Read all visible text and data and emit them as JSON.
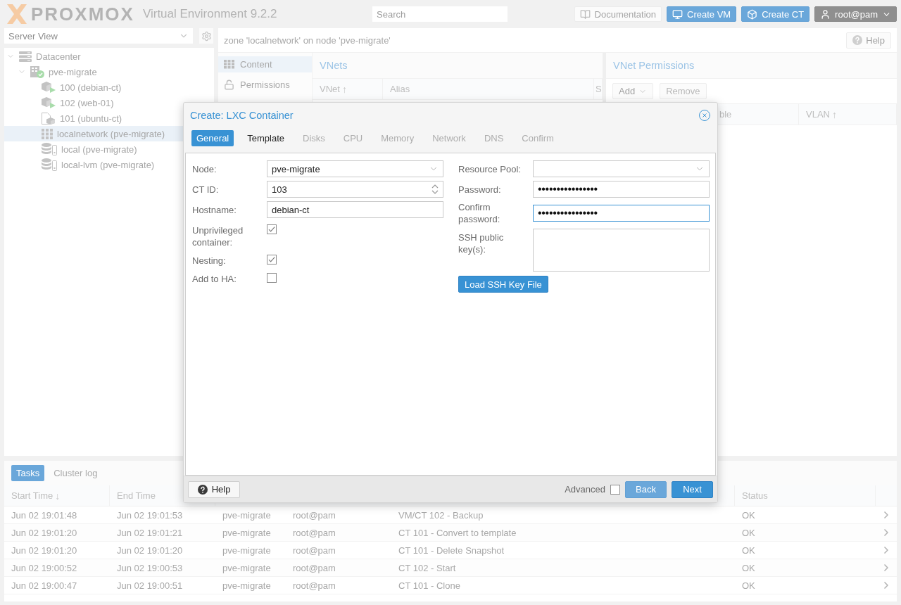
{
  "header": {
    "logo": "PROXMOX",
    "product": "Virtual Environment 9.2.2",
    "search": {
      "placeholder": "Search"
    },
    "buttons": [
      {
        "kind": "docs",
        "label": "Documentation"
      },
      {
        "kind": "create-vm",
        "label": "Create VM"
      },
      {
        "kind": "create-ct",
        "label": "Create CT"
      },
      {
        "kind": "user",
        "label": "root@pam"
      }
    ]
  },
  "view_selector": {
    "value": "Server View"
  },
  "tree": [
    {
      "label": "Datacenter",
      "kind": "datacenter",
      "expanded": true,
      "selected": false,
      "children": [
        {
          "label": "pve-migrate",
          "kind": "node",
          "expanded": true,
          "selected": false,
          "children": [
            {
              "label": "100 (debian-ct)",
              "kind": "ct-running",
              "selected": false
            },
            {
              "label": "102 (web-01)",
              "kind": "ct-running",
              "selected": false
            },
            {
              "label": "101 (ubuntu-ct)",
              "kind": "ct-template",
              "selected": false
            },
            {
              "label": "localnetwork (pve-migrate)",
              "kind": "zone",
              "selected": true
            },
            {
              "label": "local (pve-migrate)",
              "kind": "storage",
              "selected": false
            },
            {
              "label": "local-lvm (pve-migrate)",
              "kind": "storage",
              "selected": false
            }
          ]
        }
      ]
    }
  ],
  "content": {
    "title": "zone 'localnetwork' on node 'pve-migrate'",
    "help_button": "Help",
    "nav": [
      {
        "label": "Content",
        "kind": "content",
        "selected": true
      },
      {
        "label": "Permissions",
        "kind": "permissions",
        "selected": false
      }
    ],
    "vnets": {
      "title": "VNets",
      "columns": [
        {
          "label": "VNet",
          "sort": "↑"
        },
        {
          "label": "Alias"
        },
        {
          "label": "S"
        }
      ]
    },
    "vnet_permissions": {
      "title": "VNet Permissions",
      "toolbar": [
        {
          "label": "Add",
          "kind": "menu",
          "disabled": false
        },
        {
          "label": "Remove",
          "kind": "plain",
          "disabled": true
        }
      ],
      "columns": [
        {
          "label": "ble"
        },
        {
          "label": "VLAN",
          "sort": "↑"
        }
      ]
    }
  },
  "bottom": {
    "tabs": [
      {
        "label": "Tasks",
        "selected": true
      },
      {
        "label": "Cluster log",
        "selected": false
      }
    ],
    "columns": [
      {
        "label": "Start Time",
        "sort": "↓"
      },
      {
        "label": "End Time"
      },
      {
        "label": "Status"
      }
    ],
    "rows": [
      {
        "start": "Jun 02 19:01:48",
        "end": "Jun 02 19:01:53",
        "node": "pve-migrate",
        "user": "root@pam",
        "description": "VM/CT 102 - Backup",
        "status": "OK"
      },
      {
        "start": "Jun 02 19:01:20",
        "end": "Jun 02 19:01:21",
        "node": "pve-migrate",
        "user": "root@pam",
        "description": "CT 101 - Convert to template",
        "status": "OK"
      },
      {
        "start": "Jun 02 19:01:20",
        "end": "Jun 02 19:01:20",
        "node": "pve-migrate",
        "user": "root@pam",
        "description": "CT 101 - Delete Snapshot",
        "status": "OK"
      },
      {
        "start": "Jun 02 19:00:52",
        "end": "Jun 02 19:00:53",
        "node": "pve-migrate",
        "user": "root@pam",
        "description": "CT 102 - Start",
        "status": "OK"
      },
      {
        "start": "Jun 02 19:00:47",
        "end": "Jun 02 19:00:51",
        "node": "pve-migrate",
        "user": "root@pam",
        "description": "CT 101 - Clone",
        "status": "OK"
      }
    ]
  },
  "dialog": {
    "title": "Create: LXC Container",
    "tabs": [
      {
        "label": "General",
        "selected": true,
        "disabled": false
      },
      {
        "label": "Template",
        "selected": false,
        "disabled": false
      },
      {
        "label": "Disks",
        "selected": false,
        "disabled": true
      },
      {
        "label": "CPU",
        "selected": false,
        "disabled": true
      },
      {
        "label": "Memory",
        "selected": false,
        "disabled": true
      },
      {
        "label": "Network",
        "selected": false,
        "disabled": true
      },
      {
        "label": "DNS",
        "selected": false,
        "disabled": true
      },
      {
        "label": "Confirm",
        "selected": false,
        "disabled": true
      }
    ],
    "left_fields": [
      {
        "kind": "combo",
        "label": "Node:",
        "value": "pve-migrate"
      },
      {
        "kind": "spinner",
        "label": "CT ID:",
        "value": "103"
      },
      {
        "kind": "text",
        "label": "Hostname:",
        "value": "debian-ct"
      },
      {
        "kind": "checkbox",
        "label": "Unprivileged container:",
        "checked": true
      },
      {
        "kind": "checkbox",
        "label": "Nesting:",
        "checked": true
      },
      {
        "kind": "checkbox",
        "label": "Add to HA:",
        "checked": false
      }
    ],
    "right_fields": [
      {
        "kind": "combo",
        "label": "Resource Pool:"
      },
      {
        "kind": "password",
        "label": "Password:",
        "value": "••••••••••••••••",
        "focused": false
      },
      {
        "kind": "password",
        "label": "Confirm password:",
        "value": "••••••••••••••••",
        "focused": true
      },
      {
        "kind": "textarea",
        "label": "SSH public key(s):"
      }
    ],
    "load_button": "Load SSH Key File",
    "footer": {
      "help": "Help",
      "advanced": {
        "label": "Advanced",
        "checked": false
      },
      "buttons": [
        {
          "label": "Back",
          "disabled": true
        },
        {
          "label": "Next",
          "disabled": false
        }
      ]
    }
  }
}
